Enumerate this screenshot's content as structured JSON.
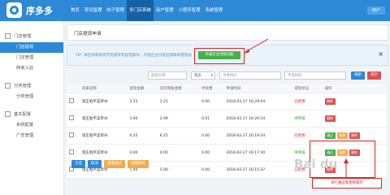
{
  "app": {
    "brand": "序多多",
    "user_button": "用户"
  },
  "nav": [
    "首页",
    "资讯管理",
    "帖子管理",
    "多门店系统",
    "用户管理",
    "小程序管理",
    "系统管理"
  ],
  "sidebar": [
    {
      "title": "门店管理",
      "items": [
        {
          "label": "门店提现"
        },
        {
          "label": "门店管理"
        },
        {
          "label": "商家入驻"
        }
      ]
    },
    {
      "title": "分类管理",
      "items": [
        {
          "label": "分类管理"
        }
      ]
    },
    {
      "title": "基本配置",
      "items": [
        {
          "label": "系统配置"
        },
        {
          "label": "广告管理"
        }
      ]
    }
  ],
  "page": {
    "title": "门店提现申请"
  },
  "tip": {
    "text": "TIP: 请在商家系统内完成所有提现操作，开通企业付款后请联系管理员",
    "open_button": "开通企业付款功能",
    "close": "×"
  },
  "filters": {
    "keyword_placeholder": "商家名称",
    "status": "状态",
    "start_placeholder": "申请时间",
    "end_placeholder": "申请时间",
    "search_button": "搜索",
    "reset_button": "清空"
  },
  "table": {
    "headers": [
      "",
      "商家名称",
      "提现金额",
      "实际到账金额",
      "手续费",
      "申请时间",
      "提现状态",
      "操作"
    ],
    "rows": [
      {
        "name": "瑞王框平菜单州",
        "amount": "3.25",
        "actual": "3.25",
        "fee": "0.00",
        "time": "2018-02-27 16:29:04",
        "status": "已拒绝",
        "status_type": "red",
        "ops": [
          "删除"
        ]
      },
      {
        "name": "瑞王框平菜单州",
        "amount": "3.00",
        "actual": "2.99",
        "fee": "0.01",
        "time": "2018-02-27 16:20:34",
        "status": "待审核",
        "status_type": "green",
        "ops": [
          "删除"
        ]
      },
      {
        "name": "瑞王框平菜单州",
        "amount": "6.25",
        "actual": "6.25",
        "fee": "0.00",
        "time": "2018-02-27 16:19:24",
        "status": "已拒绝",
        "status_type": "red",
        "ops": [
          "通过",
          "拒绝",
          "删除"
        ]
      },
      {
        "name": "瑞王框平菜单州",
        "amount": "4.00",
        "actual": "4.00",
        "fee": "0.00",
        "time": "2018-02-27 16:17:40",
        "status": "待审核",
        "status_type": "green",
        "ops": [
          "通过",
          "拒绝",
          "删除"
        ]
      },
      {
        "name": "瑞王框平菜单州",
        "amount": "5.00",
        "actual": "5.00",
        "fee": "0.00",
        "time": "2018-02-27 16:15:37",
        "status": "已拒绝",
        "status_type": "red",
        "ops": [
          "删除"
        ]
      }
    ]
  },
  "bottom_buttons": [
    "全选",
    "取消",
    "批量通过",
    "批量删除"
  ],
  "annotation": "进行通过和拒绝操作",
  "colors": {
    "primary": "#2d88d6",
    "green": "#4cae4c",
    "red": "#e0201d",
    "orange": "#f0ad4e"
  }
}
